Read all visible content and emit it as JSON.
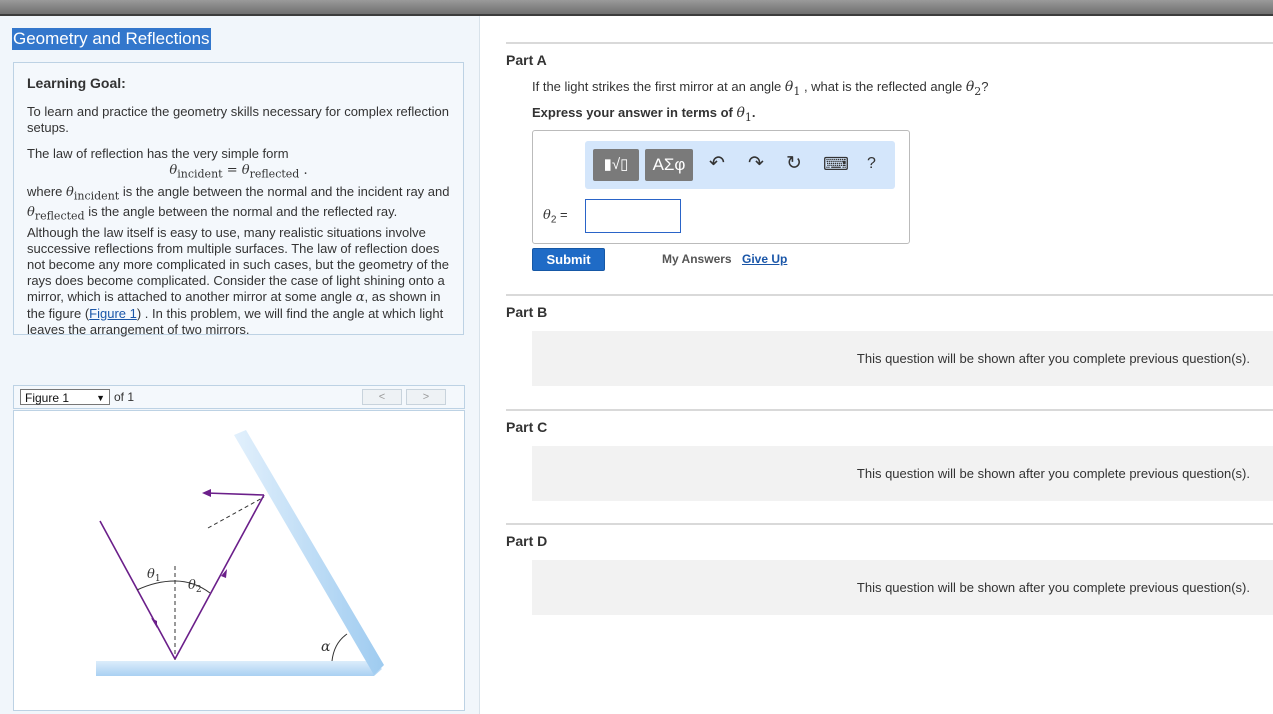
{
  "title": "Geometry and Reflections",
  "goal": {
    "heading": "Learning Goal:",
    "para1": "To learn and practice the geometry skills necessary for complex reflection setups.",
    "para2_intro": "The law of reflection has the very simple form",
    "eq": {
      "lhs": "θ",
      "lhs_sub": "incident",
      "equals": " = ",
      "rhs": "θ",
      "rhs_sub": "reflected",
      "end": " ."
    },
    "p3": {
      "where": "where ",
      "theta": "θ",
      "sub_incident": "incident",
      "mid1": " is the angle between the normal and the incident ray and ",
      "sub_reflected": "reflected",
      "mid2": " is the angle between the normal and the reflected ray. Although the law itself is easy to use, many realistic situations involve successive reflections from multiple surfaces. The law of reflection does not become any more complicated in such cases, but the geometry of the rays does become complicated. Consider the case of light shining onto a mirror, which is attached to another mirror at some angle ",
      "alpha": "α",
      "mid3": ", as shown in the figure (",
      "figure_link": "Figure 1",
      "mid4": ") . In this problem, we will find the angle at which light leaves the arrangement of two mirrors."
    }
  },
  "figure_nav": {
    "select": "Figure 1",
    "of": "of 1",
    "prev": "<",
    "next": ">"
  },
  "figure_labels": {
    "theta1": "θ",
    "theta1_sub": "1",
    "theta2": "θ",
    "theta2_sub": "2",
    "alpha": "α"
  },
  "parts": {
    "a": {
      "label": "Part A",
      "q_pre": "If the light strikes the first mirror at an angle ",
      "q_theta1": "θ",
      "q_sub1": "1",
      "q_mid": " , what is the reflected angle ",
      "q_theta2": "θ",
      "q_sub2": "2",
      "q_end": "?",
      "express_pre": "Express your answer in terms of ",
      "express_theta": "θ",
      "express_sub": "1",
      "express_end": ".",
      "toolbar": {
        "templates": "▮√▯",
        "greek": "ΑΣφ",
        "undo": "↶",
        "redo": "↷",
        "reset": "↻",
        "keyboard": "⌨",
        "help": "?"
      },
      "answer_label_theta": "θ",
      "answer_label_sub": "2",
      "answer_label_eq": " =",
      "answer_value": "",
      "submit": "Submit",
      "my_answers": "My Answers",
      "give_up": "Give Up"
    },
    "b": {
      "label": "Part B",
      "locked": "This question will be shown after you complete previous question(s)."
    },
    "c": {
      "label": "Part C",
      "locked": "This question will be shown after you complete previous question(s)."
    },
    "d": {
      "label": "Part D",
      "locked": "This question will be shown after you complete previous question(s)."
    }
  },
  "colors": {
    "ray": "#6b1f8a",
    "mirror": "#b9daf5",
    "link": "#1a56a8",
    "submit": "#1f6bc6",
    "title_bg": "#3377cc"
  }
}
